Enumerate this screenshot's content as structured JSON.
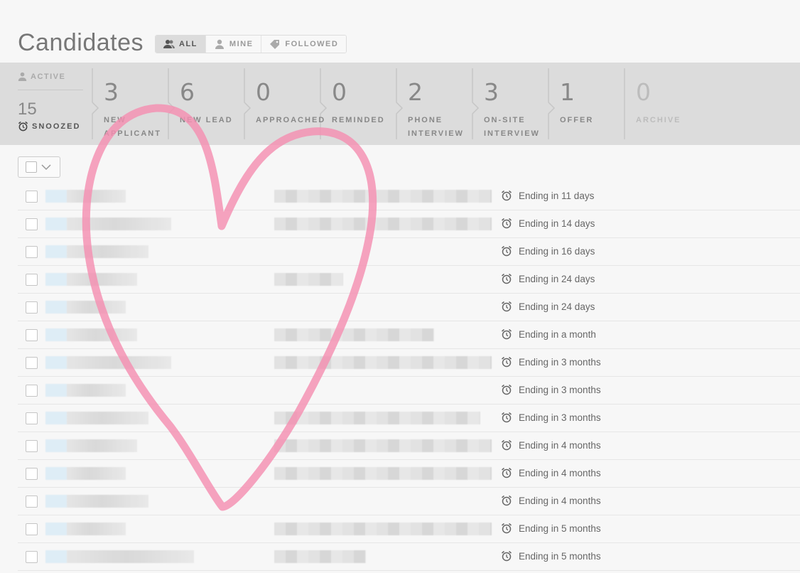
{
  "header": {
    "title": "Candidates",
    "filters": [
      {
        "label": "ALL",
        "icon": "people-icon",
        "active": true
      },
      {
        "label": "MINE",
        "icon": "person-icon",
        "active": false
      },
      {
        "label": "FOLLOWED",
        "icon": "tag-icon",
        "active": false
      }
    ]
  },
  "pipeline": {
    "active_label": "ACTIVE",
    "snoozed_count": "15",
    "snoozed_label": "SNOOZED",
    "stages": [
      {
        "count": "3",
        "label": "NEW APPLICANT"
      },
      {
        "count": "6",
        "label": "NEW LEAD"
      },
      {
        "count": "0",
        "label": "APPROACHED"
      },
      {
        "count": "0",
        "label": "REMINDED"
      },
      {
        "count": "2",
        "label": "PHONE INTERVIEW"
      },
      {
        "count": "3",
        "label": "ON-SITE INTERVIEW"
      },
      {
        "count": "1",
        "label": "OFFER"
      },
      {
        "count": "0",
        "label": "ARCHIVE"
      }
    ]
  },
  "rows": [
    {
      "status": "Ending in 11 days"
    },
    {
      "status": "Ending in 14 days"
    },
    {
      "status": "Ending in 16 days"
    },
    {
      "status": "Ending in 24 days"
    },
    {
      "status": "Ending in 24 days"
    },
    {
      "status": "Ending in a month"
    },
    {
      "status": "Ending in 3 months"
    },
    {
      "status": "Ending in 3 months"
    },
    {
      "status": "Ending in 3 months"
    },
    {
      "status": "Ending in 4 months"
    },
    {
      "status": "Ending in 4 months"
    },
    {
      "status": "Ending in 4 months"
    },
    {
      "status": "Ending in 5 months"
    },
    {
      "status": "Ending in 5 months"
    }
  ],
  "colors": {
    "heart": "#f48fb1",
    "pipeline_bg": "#dcdcdc",
    "page_bg": "#f7f7f7"
  }
}
